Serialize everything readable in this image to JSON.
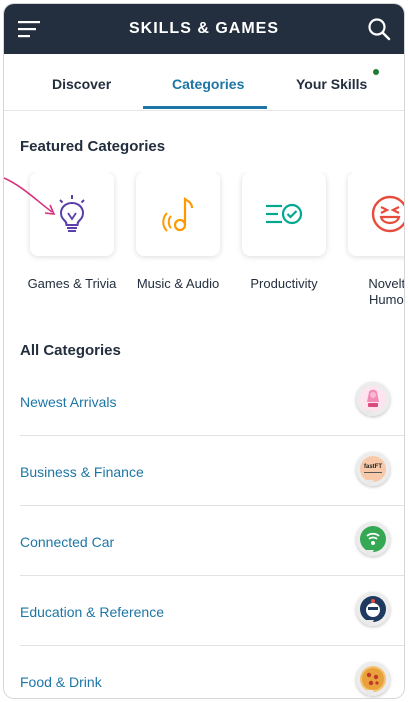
{
  "app": {
    "title": "SKILLS & GAMES"
  },
  "tabs": [
    {
      "label": "Discover"
    },
    {
      "label": "Categories"
    },
    {
      "label": "Your Skills"
    }
  ],
  "active_tab": "Categories",
  "featured": {
    "title": "Featured Categories",
    "items": [
      {
        "label": "Games & Trivia",
        "icon": "lightbulb-icon"
      },
      {
        "label": "Music & Audio",
        "icon": "music-note-icon"
      },
      {
        "label": "Productivity",
        "icon": "checklist-icon"
      },
      {
        "label_line1": "Novelty",
        "label_line2": "Humou",
        "icon": "laughing-face-icon"
      }
    ]
  },
  "all": {
    "title": "All Categories",
    "items": [
      {
        "label": "Newest Arrivals",
        "icon": "pink-figure-icon"
      },
      {
        "label": "Business & Finance",
        "icon": "fastft-icon",
        "icon_text": "fastFT"
      },
      {
        "label": "Connected Car",
        "icon": "car-signal-icon"
      },
      {
        "label": "Education & Reference",
        "icon": "robot-face-icon"
      },
      {
        "label": "Food & Drink",
        "icon": "pizza-icon"
      }
    ]
  },
  "colors": {
    "topbar": "#232f3e",
    "accent": "#1d76a6",
    "icon_purple": "#5a3fa8",
    "icon_orange": "#ff9900",
    "icon_teal": "#00a890",
    "icon_red": "#e74c3c",
    "notification_dot": "#1c7c34",
    "arrow": "#d6337c"
  }
}
